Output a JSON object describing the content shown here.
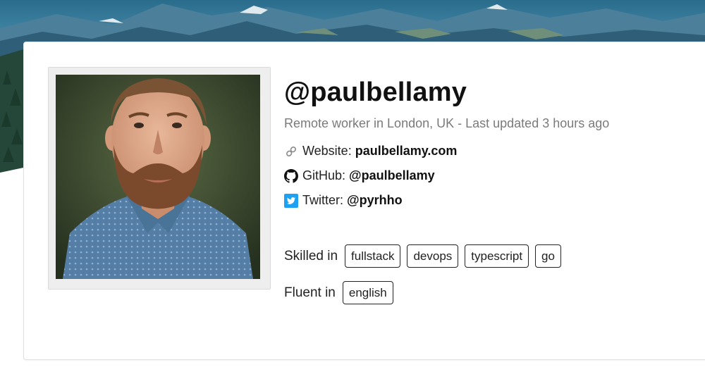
{
  "profile": {
    "username": "@paulbellamy",
    "subtitle": "Remote worker in London, UK - Last updated 3 hours ago",
    "links": {
      "website": {
        "label": "Website:",
        "value": "paulbellamy.com",
        "icon": "link-icon"
      },
      "github": {
        "label": "GitHub:",
        "value": "@paulbellamy",
        "icon": "github-icon"
      },
      "twitter": {
        "label": "Twitter:",
        "value": "@pyrhho",
        "icon": "twitter-icon"
      }
    },
    "skills": {
      "label": "Skilled in",
      "tags": [
        "fullstack",
        "devops",
        "typescript",
        "go"
      ]
    },
    "languages": {
      "label": "Fluent in",
      "tags": [
        "english"
      ]
    }
  },
  "colors": {
    "twitter_blue": "#1da1f2",
    "text": "#222222",
    "muted": "#7a7a7a"
  }
}
